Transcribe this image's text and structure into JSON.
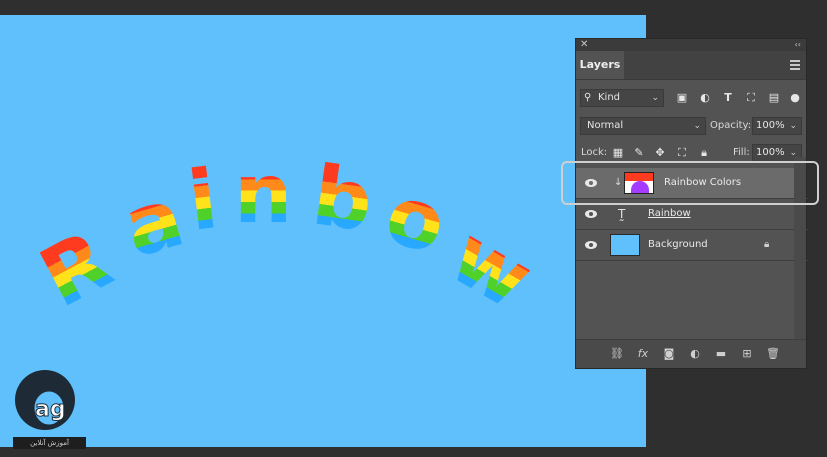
{
  "panel": {
    "tab_label": "Layers",
    "filter": {
      "kind_label": "Kind"
    },
    "blend_mode": "Normal",
    "opacity_label": "Opacity:",
    "opacity_value": "100%",
    "lock_label": "Lock:",
    "fill_label": "Fill:",
    "fill_value": "100%"
  },
  "layers": [
    {
      "name": "Rainbow Colors",
      "type": "raster",
      "selected": true,
      "visible": true
    },
    {
      "name": "Rainbow",
      "type": "text",
      "selected": false,
      "visible": true
    },
    {
      "name": "Background",
      "type": "background",
      "selected": false,
      "visible": true,
      "locked": true
    }
  ],
  "canvas": {
    "background_color": "#5fc0fb",
    "artwork_text": "Rainbow",
    "rainbow_colors": [
      "#ff3b1f",
      "#ff8a1a",
      "#ffe21a",
      "#4fd12a",
      "#28a8ff",
      "#a43cff"
    ]
  },
  "watermark": {
    "text": "آموزش آنلاین"
  },
  "colors": {
    "panel_bg": "#535353",
    "selected_row": "#6b6b6b",
    "highlight_border": "#cfcfcf"
  }
}
